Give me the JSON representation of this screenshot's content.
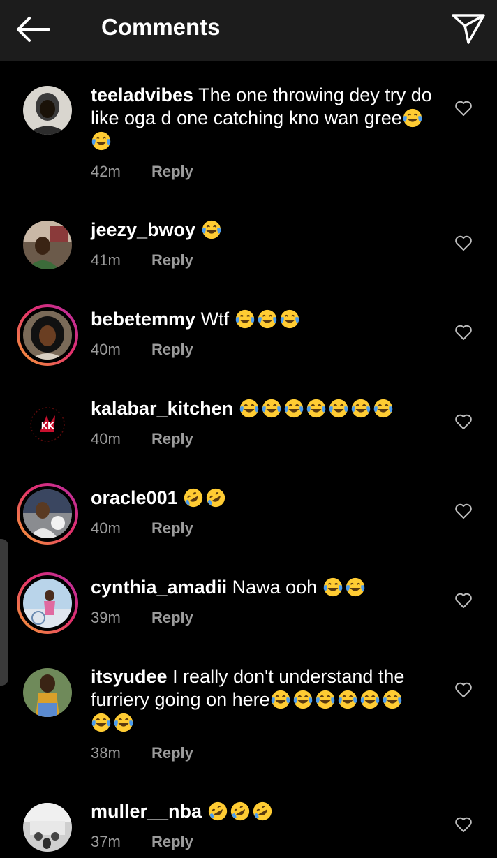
{
  "header": {
    "title": "Comments",
    "back_icon": "back-arrow-icon",
    "share_icon": "paper-plane-icon"
  },
  "colors": {
    "background": "#000000",
    "header_bg": "#1c1c1c",
    "muted_text": "#9b9b9b",
    "story_ring": [
      "#f7a234",
      "#e3306c",
      "#b52ca5"
    ]
  },
  "comments": [
    {
      "username": "teeladvibes",
      "text": "The one throwing dey try do like oga d one catching kno wan gree",
      "emoji_after_text": 2,
      "emoji": "tears-of-joy",
      "time": "42m",
      "reply": "Reply"
    },
    {
      "username": "jeezy_bwoy",
      "text": "",
      "emoji_after_text": 1,
      "emoji": "tears-of-joy",
      "time": "41m",
      "reply": "Reply"
    },
    {
      "username": "bebetemmy",
      "text": "Wtf",
      "emoji_after_text": 3,
      "emoji": "tears-of-joy",
      "time": "40m",
      "reply": "Reply"
    },
    {
      "username": "kalabar_kitchen",
      "text": "",
      "emoji_after_text": 7,
      "emoji": "tears-of-joy",
      "time": "40m",
      "reply": "Reply"
    },
    {
      "username": "oracle001",
      "text": "",
      "emoji_after_text": 2,
      "emoji": "rolling-on-floor-laughing",
      "time": "40m",
      "reply": "Reply"
    },
    {
      "username": "cynthia_amadii",
      "text": "Nawa ooh",
      "emoji_after_text": 2,
      "emoji": "tears-of-joy",
      "time": "39m",
      "reply": "Reply"
    },
    {
      "username": "itsyudee",
      "text": "I really don't understand the furriery going on here",
      "emoji_after_text": 8,
      "emoji": "tears-of-joy",
      "time": "38m",
      "reply": "Reply"
    },
    {
      "username": "muller__nba",
      "text": "",
      "emoji_after_text": 3,
      "emoji": "rolling-on-floor-laughing",
      "time": "37m",
      "reply": "Reply"
    }
  ]
}
